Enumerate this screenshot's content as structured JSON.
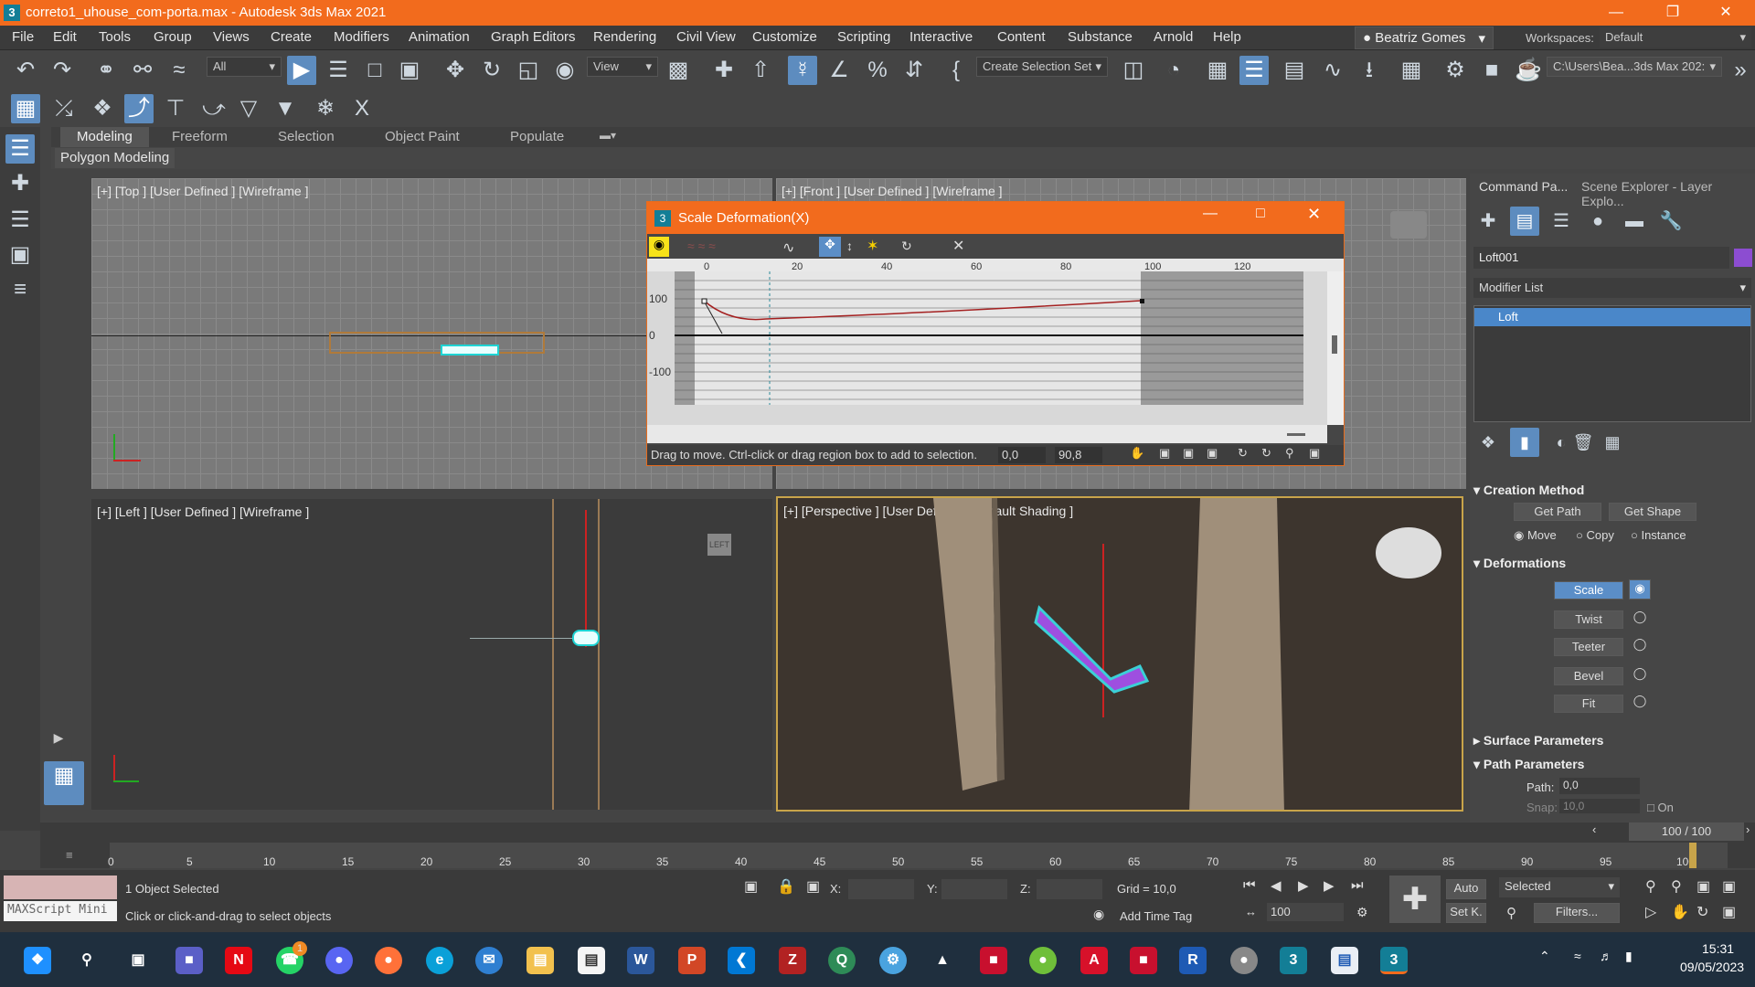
{
  "window": {
    "title": "correto1_uhouse_com-porta.max - Autodesk 3ds Max 2021",
    "app_icon": "3"
  },
  "menu": [
    "File",
    "Edit",
    "Tools",
    "Group",
    "Views",
    "Create",
    "Modifiers",
    "Animation",
    "Graph Editors",
    "Rendering",
    "Civil View",
    "Customize",
    "Scripting",
    "Interactive",
    "Content",
    "Substance",
    "Arnold",
    "Help"
  ],
  "user": "Beatriz Gomes",
  "workspaces": {
    "label": "Workspaces:",
    "value": "Default"
  },
  "toolbar": {
    "filter": "All",
    "view": "View",
    "selection_set": "Create Selection Set",
    "path": "C:\\Users\\Bea...3ds Max 202:"
  },
  "ribbon": {
    "tabs": [
      "Modeling",
      "Freeform",
      "Selection",
      "Object Paint",
      "Populate"
    ],
    "sub": "Polygon Modeling"
  },
  "viewports": {
    "top": "[+] [Top ] [User Defined ] [Wireframe ]",
    "front": "[+] [Front ] [User Defined ] [Wireframe ]",
    "left": "[+] [Left ] [User Defined ] [Wireframe ]",
    "persp": "[+] [Perspective ] [User Defined ] [Default Shading ]",
    "left_cube": "LEFT"
  },
  "dialog": {
    "title": "Scale Deformation(X)",
    "ruler": [
      "0",
      "20",
      "40",
      "60",
      "80",
      "100",
      "120"
    ],
    "yaxis": [
      "100",
      "0",
      "-100"
    ],
    "status": "Drag to move. Ctrl-click or drag region box to add to selection.",
    "x_val": "0,0",
    "y_val": "90,8"
  },
  "command_panel": {
    "tabs": [
      "Command Pa...",
      "Scene Explorer - Layer Explo..."
    ],
    "object_name": "Loft001",
    "modifier_list": "Modifier List",
    "stack_item": "Loft",
    "creation_method": {
      "title": "Creation Method",
      "get_path": "Get Path",
      "get_shape": "Get Shape",
      "move": "Move",
      "copy": "Copy",
      "instance": "Instance"
    },
    "deformations": {
      "title": "Deformations",
      "items": [
        "Scale",
        "Twist",
        "Teeter",
        "Bevel",
        "Fit"
      ]
    },
    "surface": "Surface Parameters",
    "path_params": {
      "title": "Path Parameters",
      "path_label": "Path:",
      "path_value": "0,0",
      "snap_label": "Snap:",
      "snap_value": "10,0",
      "on": "On"
    }
  },
  "timeline": {
    "frame": "100 / 100",
    "ticks": [
      "0",
      "5",
      "10",
      "15",
      "20",
      "25",
      "30",
      "35",
      "40",
      "45",
      "50",
      "55",
      "60",
      "65",
      "70",
      "75",
      "80",
      "85",
      "90",
      "95",
      "100"
    ]
  },
  "status": {
    "maxscript": "MAXScript Mini",
    "selected": "1 Object Selected",
    "prompt": "Click or click-and-drag to select objects",
    "x": "X:",
    "y": "Y:",
    "z": "Z:",
    "grid": "Grid = 10,0",
    "time_tag": "Add Time Tag",
    "auto": "Auto",
    "setk": "Set K.",
    "selected_dd": "Selected",
    "filters": "Filters...",
    "frame": "100"
  },
  "taskbar": {
    "time": "15:31",
    "date": "09/05/2023",
    "whatsapp_badge": "1"
  }
}
